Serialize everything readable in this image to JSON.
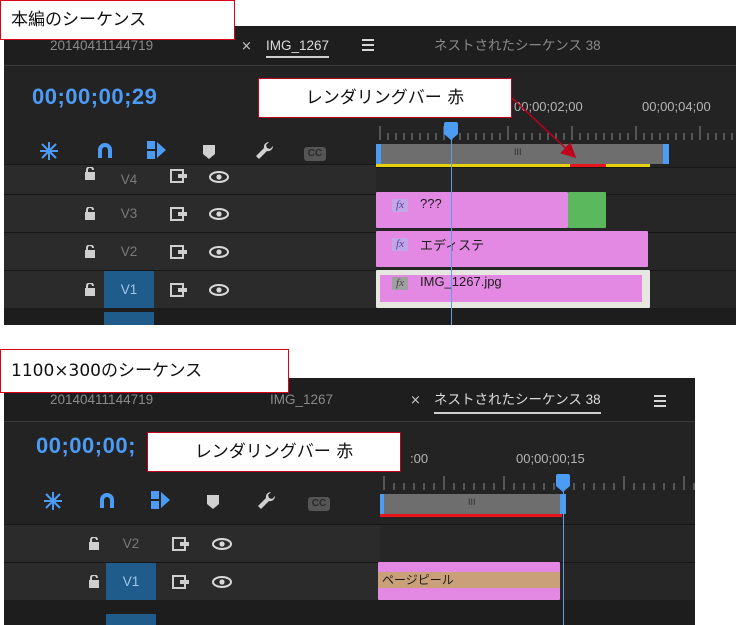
{
  "colors": {
    "panel_bg": "#232323",
    "timecode_blue": "#4c9bf5",
    "render_bar_red": "#e8141c",
    "render_bar_yellow": "#e6d20a",
    "clip_pink": "#e389e3",
    "clip_green": "#5cb85c",
    "clip_tan": "#c9a07a",
    "annotation_red": "#e0001a",
    "target_track_blue": "#1f5b8b"
  },
  "section1": {
    "caption": "本編のシーケンス",
    "tabs": [
      {
        "label": "20140411144719"
      },
      {
        "label": "IMG_1267",
        "close": "×",
        "active": true
      },
      {
        "label": "ネストされたシーケンス 38"
      }
    ],
    "timecode": "00;00;00;29",
    "ruler_labels": [
      "00;00;02;00",
      "00;00;04;00"
    ],
    "render_bar_callout": "レンダリングバー 赤",
    "tracks": [
      {
        "name": "V4",
        "target": false
      },
      {
        "name": "V3",
        "target": false
      },
      {
        "name": "V2",
        "target": false
      },
      {
        "name": "V1",
        "target": true
      }
    ],
    "clips": {
      "v3": {
        "label": "???",
        "fx": "fx"
      },
      "v2": {
        "label": "エディステ",
        "fx": "fx"
      },
      "v1": {
        "label": "IMG_1267.jpg",
        "fx": "fx"
      }
    },
    "work_area_handle": "III"
  },
  "section2": {
    "caption": "1100×300のシーケンス",
    "tabs": [
      {
        "label": "20140411144719"
      },
      {
        "label": "IMG_1267"
      },
      {
        "label": "ネストされたシーケンス 38",
        "close": "×",
        "active": true
      }
    ],
    "timecode": "00;00;00;",
    "ruler_labels": [
      ":00",
      "00;00;00;15"
    ],
    "render_bar_callout": "レンダリングバー 赤",
    "tracks": [
      {
        "name": "V2",
        "target": false
      },
      {
        "name": "V1",
        "target": true
      }
    ],
    "clips": {
      "v1": {
        "label": "ページピール"
      }
    },
    "work_area_handle": "III"
  },
  "icons": [
    "snap-icon",
    "magnet-icon",
    "add-marker-icon",
    "marker-icon",
    "wrench-icon",
    "captions-icon",
    "lock-icon",
    "sync-lock-icon",
    "eye-icon"
  ]
}
